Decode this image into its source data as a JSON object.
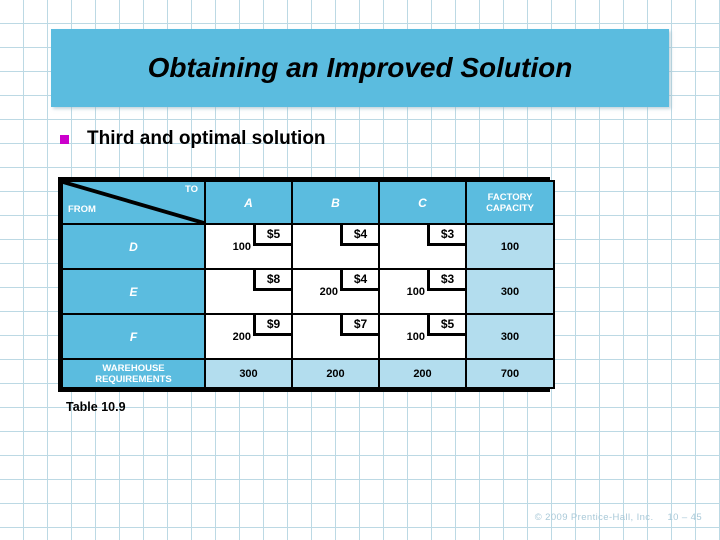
{
  "slide": {
    "title": "Obtaining an Improved Solution",
    "bullet": {
      "marker": "square-bullet-icon",
      "label": "Third and optimal solution"
    },
    "caption": "Table 10.9",
    "footer": {
      "copyright": "© 2009 Prentice-Hall, Inc.",
      "page": "10 – 45"
    },
    "colors": {
      "banner": "#5bbcdf",
      "header_cell": "#5bbcdf",
      "capacity_cell": "#b3ddee",
      "bullet": "#cc00cc",
      "grid": "#bcd9e4",
      "footer_text": "#a9c9d8"
    }
  },
  "table": {
    "corner": {
      "to_label": "TO",
      "from_label": "FROM"
    },
    "destination_headers": [
      "A",
      "B",
      "C"
    ],
    "capacity_header": "FACTORY CAPACITY",
    "capacity_header_line1": "FACTORY",
    "capacity_header_line2": "CAPACITY",
    "requirements_label_line1": "WAREHOUSE",
    "requirements_label_line2": "REQUIREMENTS",
    "rows": [
      {
        "source": "D",
        "cells": [
          {
            "allocation": "100",
            "cost": "$5"
          },
          {
            "allocation": "",
            "cost": "$4"
          },
          {
            "allocation": "",
            "cost": "$3"
          }
        ],
        "capacity": "100"
      },
      {
        "source": "E",
        "cells": [
          {
            "allocation": "",
            "cost": "$8"
          },
          {
            "allocation": "200",
            "cost": "$4"
          },
          {
            "allocation": "100",
            "cost": "$3"
          }
        ],
        "capacity": "300"
      },
      {
        "source": "F",
        "cells": [
          {
            "allocation": "200",
            "cost": "$9"
          },
          {
            "allocation": "",
            "cost": "$7"
          },
          {
            "allocation": "100",
            "cost": "$5"
          }
        ],
        "capacity": "300"
      }
    ],
    "requirements": [
      "300",
      "200",
      "200"
    ],
    "total": "700"
  }
}
